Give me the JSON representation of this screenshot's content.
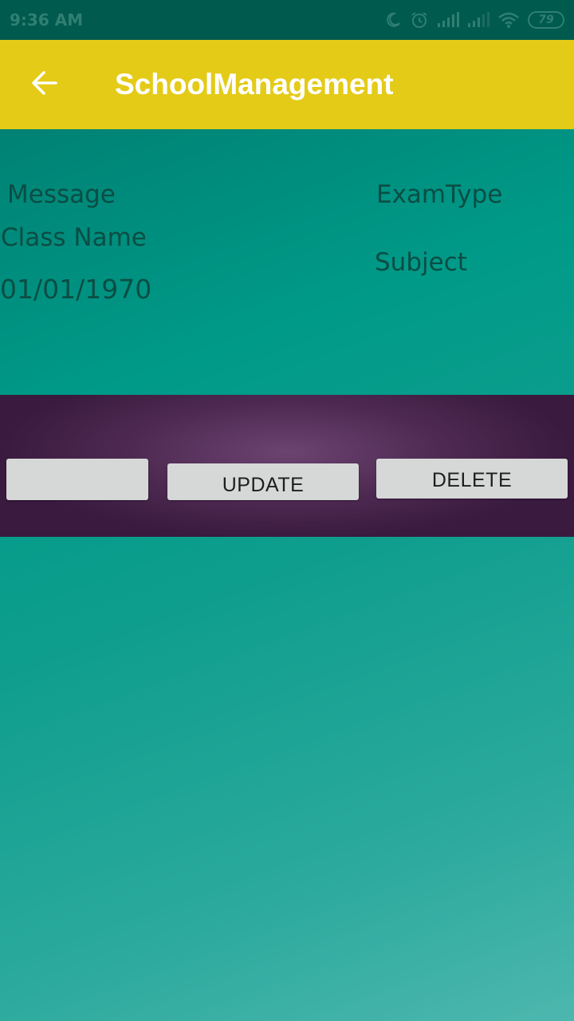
{
  "status_bar": {
    "time": "9:36 AM",
    "battery": "79",
    "icons": [
      "moon-icon",
      "alarm-icon",
      "signal-icon",
      "signal-weak-icon",
      "wifi-icon",
      "battery-icon"
    ]
  },
  "app_bar": {
    "back_icon": "arrow-left-icon",
    "title": "SchoolManagement"
  },
  "info": {
    "message": "Message",
    "exam_type": "ExamType",
    "class_name": "Class Name",
    "subject": "Subject",
    "date": "01/01/1970"
  },
  "actions": {
    "blank_label": "",
    "update_label": "UPDATE",
    "delete_label": "DELETE"
  },
  "colors": {
    "app_bar": "#e4cb17",
    "status_bar": "#005a4e",
    "action_band": "#4e2a52",
    "text": "#0b4d44",
    "button": "#d6d7d7"
  }
}
